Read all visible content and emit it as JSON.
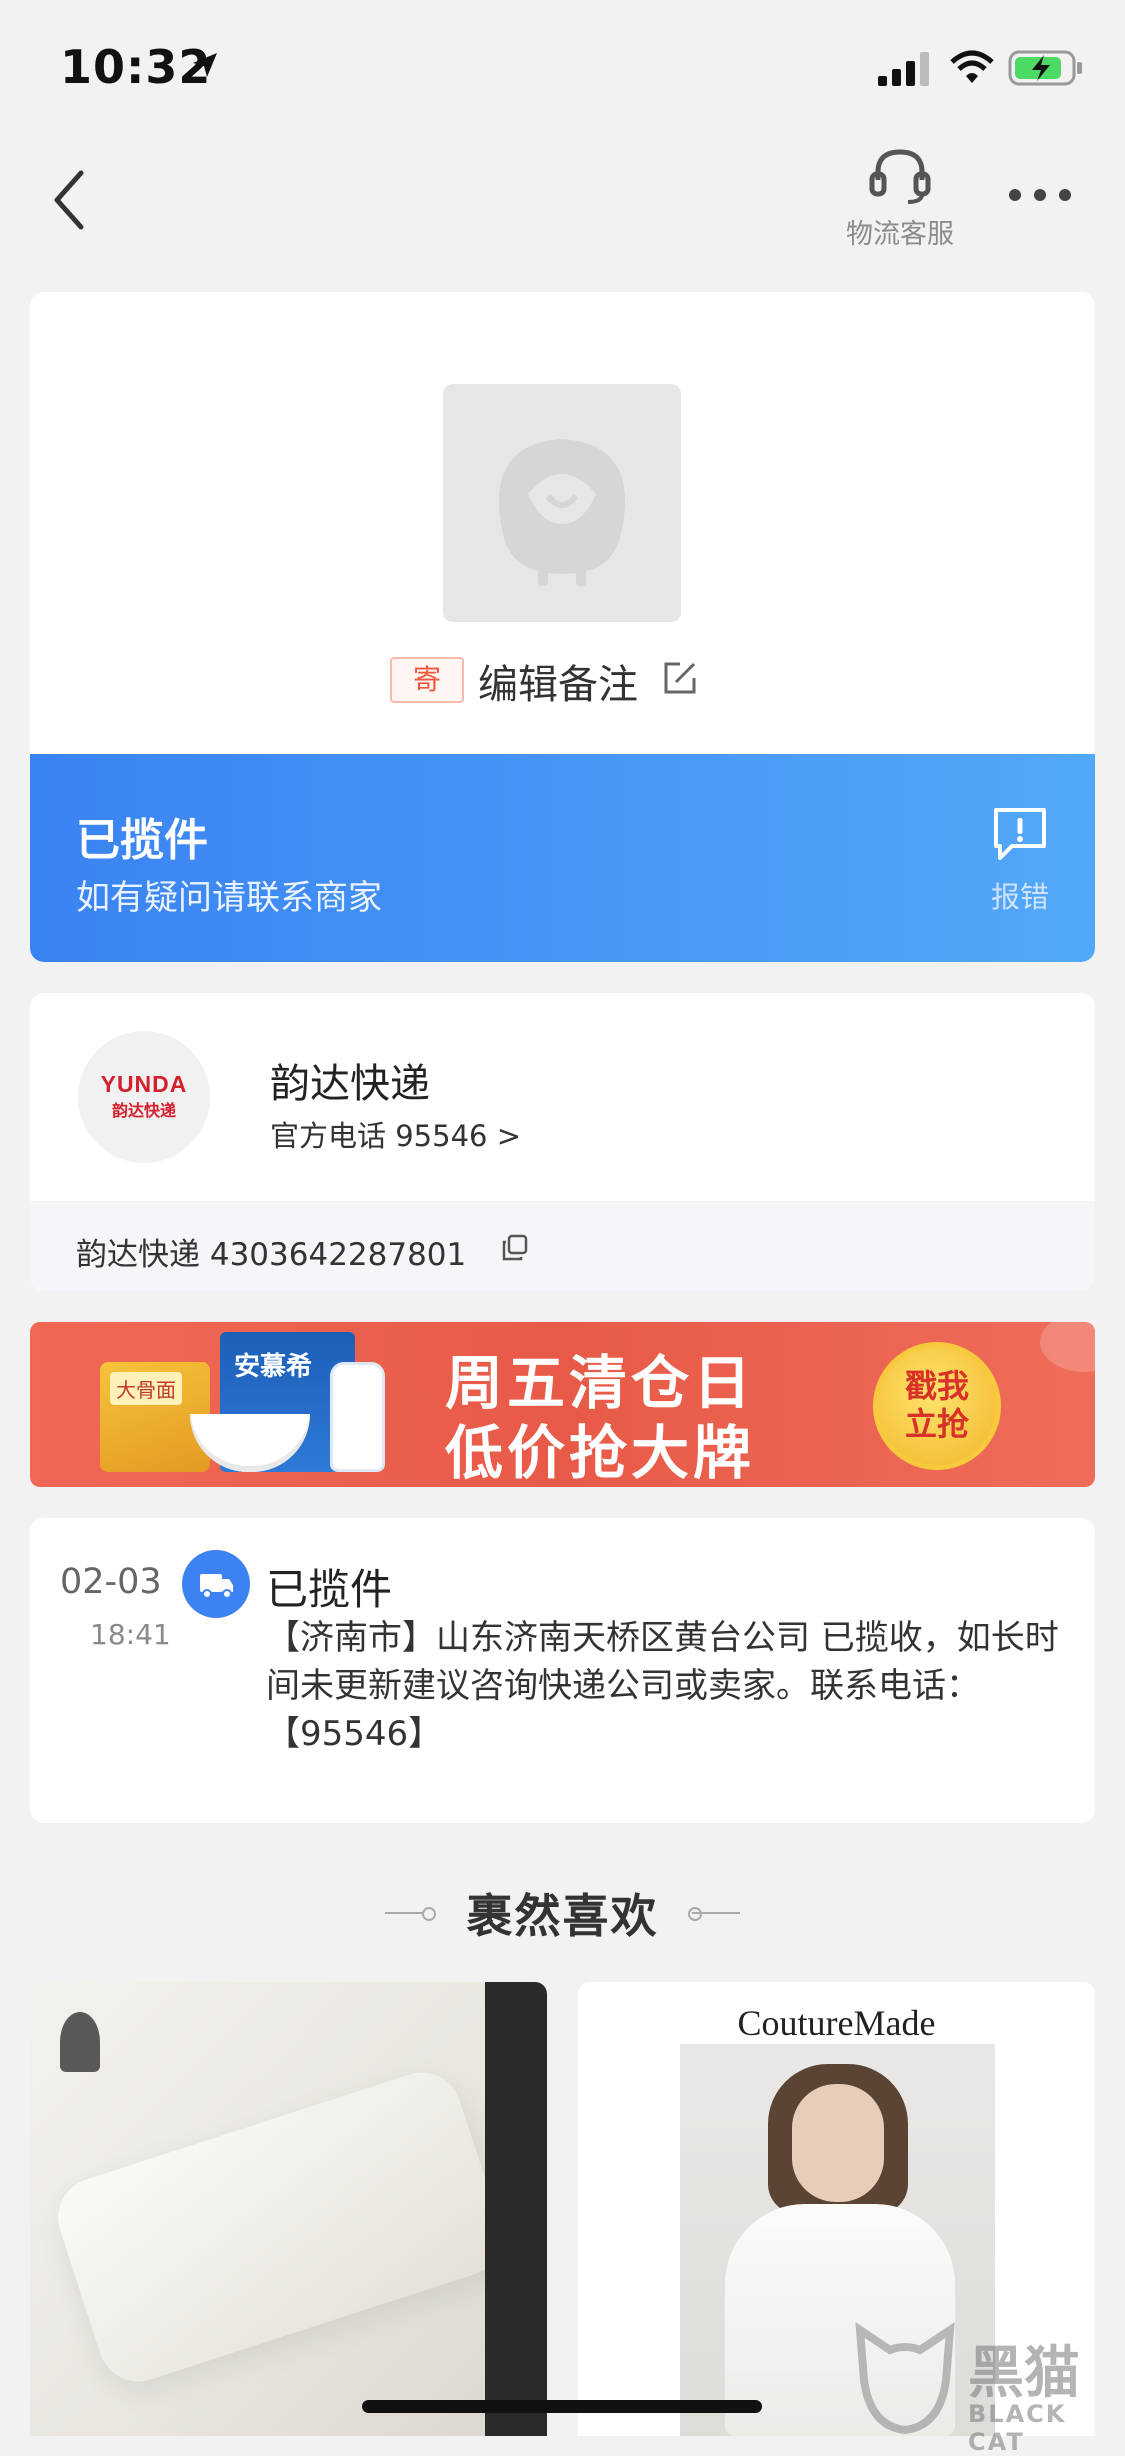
{
  "status_bar": {
    "time": "10:32",
    "icons": [
      "location-arrow-icon",
      "signal-icon",
      "wifi-icon",
      "battery-charging-icon"
    ]
  },
  "nav": {
    "back_icon": "chevron-left-icon",
    "service_label": "物流客服",
    "service_icon": "headset-icon",
    "more_icon": "more-dots-icon"
  },
  "package": {
    "badge": "寄",
    "edit_note": "编辑备注",
    "edit_icon": "edit-icon",
    "status_title": "已揽件",
    "status_subtitle": "如有疑问请联系商家",
    "report_label": "报错",
    "report_icon": "chat-alert-icon",
    "banner_colors": [
      "#3a83f2",
      "#52a8f8"
    ]
  },
  "courier": {
    "logo_text_en": "YUNDA",
    "logo_text_cn": "韵达快递",
    "name": "韵达快递",
    "phone": "官方电话 95546 >",
    "tracking": "韵达快递 4303642287801",
    "copy_icon": "copy-icon"
  },
  "promo": {
    "line1": "周五清仓日",
    "line2": "低价抢大牌",
    "cta": "戳我立抢",
    "product_noodle": "大骨面",
    "product_milk": "安慕希"
  },
  "timeline": [
    {
      "date": "02-03",
      "time": "18:41",
      "icon": "delivery-truck-icon",
      "title": "已揽件",
      "description": "【济南市】山东济南天桥区黄台公司 已揽收，如长时间未更新建议咨询快递公司或卖家。联系电话：【95546】"
    }
  ],
  "recommend": {
    "title": "裹然喜欢",
    "products": [
      {
        "brand": ""
      },
      {
        "brand": "CoutureMade"
      }
    ]
  },
  "watermark": {
    "cn": "黑猫",
    "en": "BLACK CAT"
  }
}
